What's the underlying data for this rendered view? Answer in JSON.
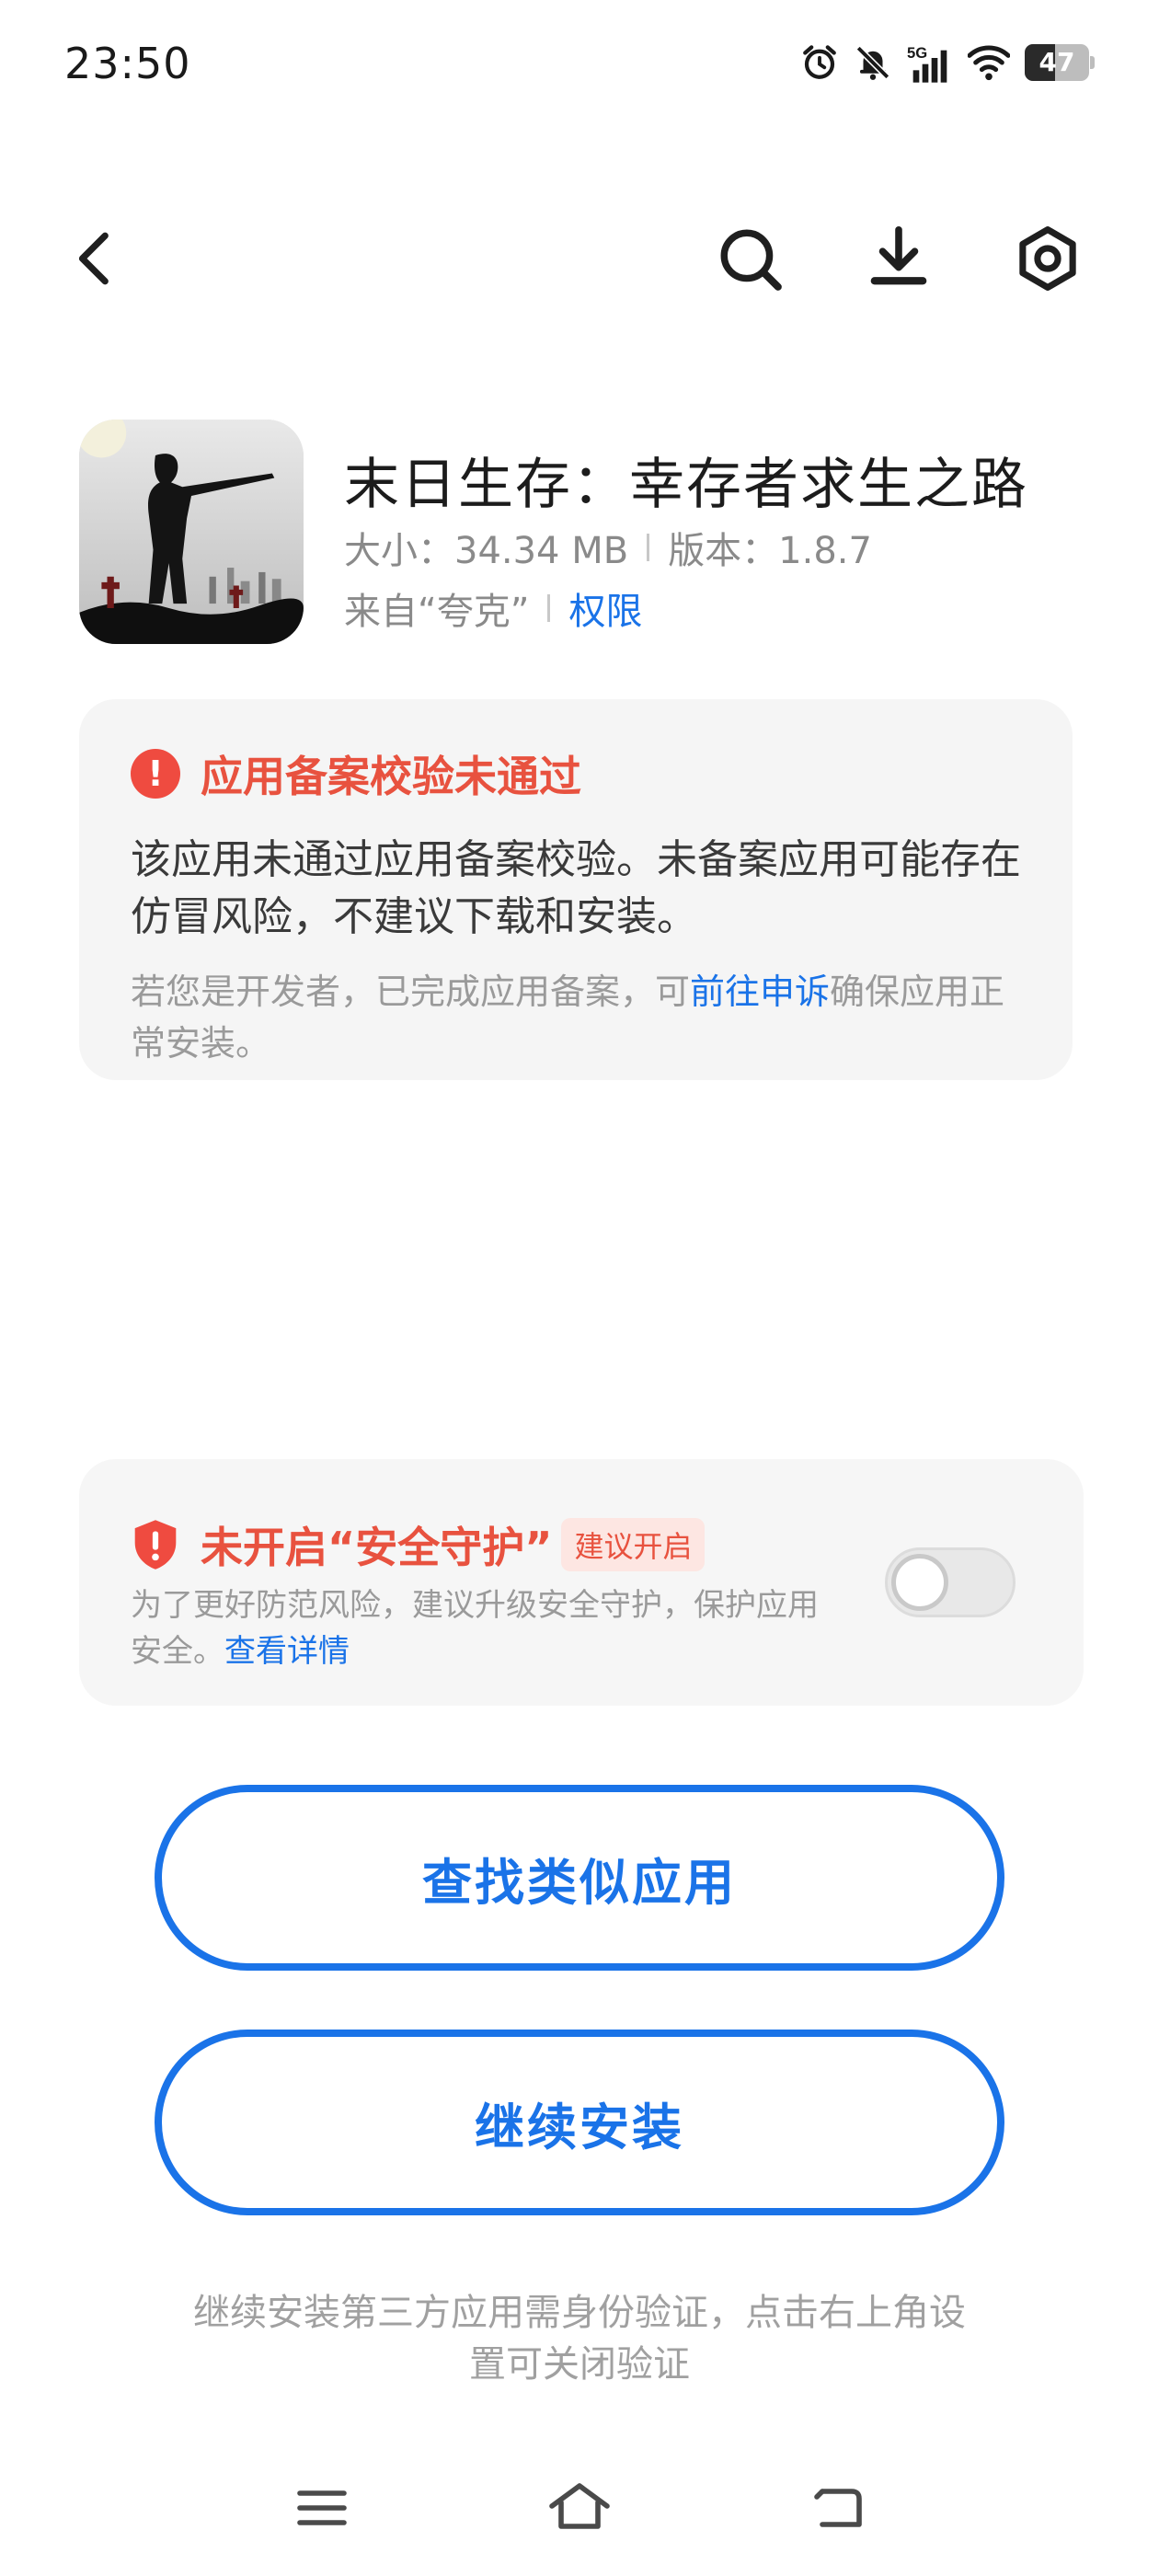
{
  "status_bar": {
    "time": "23:50",
    "network": "5G",
    "battery": "47",
    "battery_level": 0.47,
    "icons": [
      "alarm-icon",
      "mute-icon",
      "signal-5g-icon",
      "wifi-icon",
      "battery-icon"
    ]
  },
  "toolbar": {
    "back_icon": "chevron-left-icon",
    "search_icon": "search-icon",
    "download_icon": "download-icon",
    "settings_icon": "settings-icon"
  },
  "app": {
    "name": "末日生存：幸存者求生之路",
    "size": "大小：34.34 MB",
    "version": "版本：1.8.7",
    "source": "来自“夸克”",
    "permissions_link": "权限"
  },
  "warning": {
    "title": "应用备案校验未通过",
    "icon_text": "!",
    "body": "该应用未通过应用备案校验。未备案应用可能存在仿冒风险，不建议下载和安装。",
    "sub_prefix": "若您是开发者，已完成应用备案，可",
    "sub_link": "前往申诉",
    "sub_suffix": "确保应用正常安装。"
  },
  "security": {
    "title": "未开启“安全守护”",
    "badge": "建议开启",
    "desc": "为了更好防范风险，建议升级安全守护，保护应用安全。",
    "details_link": "查看详情",
    "toggle_on": false
  },
  "buttons": {
    "find_similar": "查找类似应用",
    "continue_install": "继续安装"
  },
  "footer_note": "继续安装第三方应用需身份验证，点击右上角设置可关闭验证",
  "colors": {
    "accent": "#1a73e8",
    "warning": "#e8523f",
    "card_bg": "#f5f5f5"
  }
}
